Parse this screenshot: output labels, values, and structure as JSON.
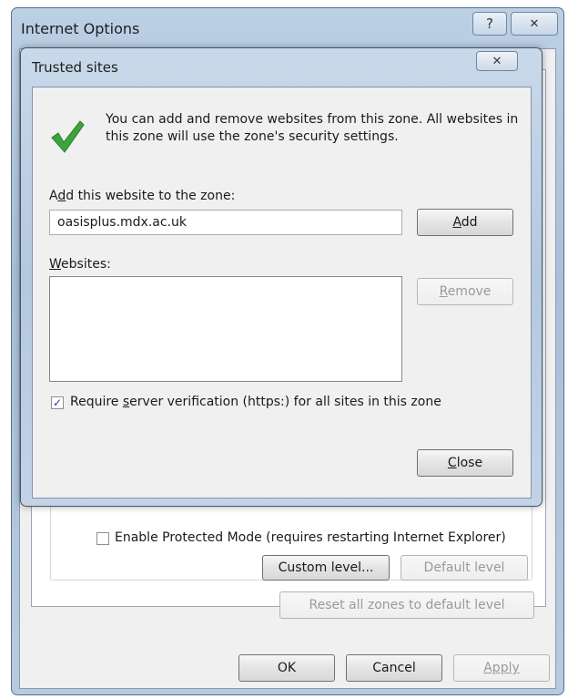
{
  "internet_options": {
    "title": "Internet Options",
    "help_icon": "?",
    "close_icon": "✕",
    "protected_mode_label": "Enable Protected Mode (requires restarting Internet Explorer)",
    "protected_mode_checked": false,
    "custom_level_label": "Custom level...",
    "default_level_label": "Default level",
    "reset_zones_label": "Reset all zones to default level",
    "ok_label": "OK",
    "cancel_label": "Cancel",
    "apply_label": "Apply"
  },
  "trusted_sites": {
    "title": "Trusted sites",
    "close_icon": "✕",
    "info_text": "You can add and remove websites from this zone. All websites in this zone will use the zone's security settings.",
    "add_label_pre": "A",
    "add_label_key": "d",
    "add_label_post": "d this website to the zone:",
    "add_input_value": "oasisplus.mdx.ac.uk",
    "add_button_key": "A",
    "add_button_post": "dd",
    "websites_label_key": "W",
    "websites_label_post": "ebsites:",
    "websites": [],
    "remove_button_key": "R",
    "remove_button_post": "emove",
    "https_checked": true,
    "https_label_pre": "Require ",
    "https_label_key": "s",
    "https_label_post": "erver verification (https:) for all sites in this zone",
    "close_button_key": "C",
    "close_button_post": "lose"
  },
  "colors": {
    "check_green": "#3aa53a",
    "window_frame": "#b4c8de",
    "client_bg": "#f0f0f0"
  },
  "icons": {
    "check": "green-checkmark-icon"
  }
}
